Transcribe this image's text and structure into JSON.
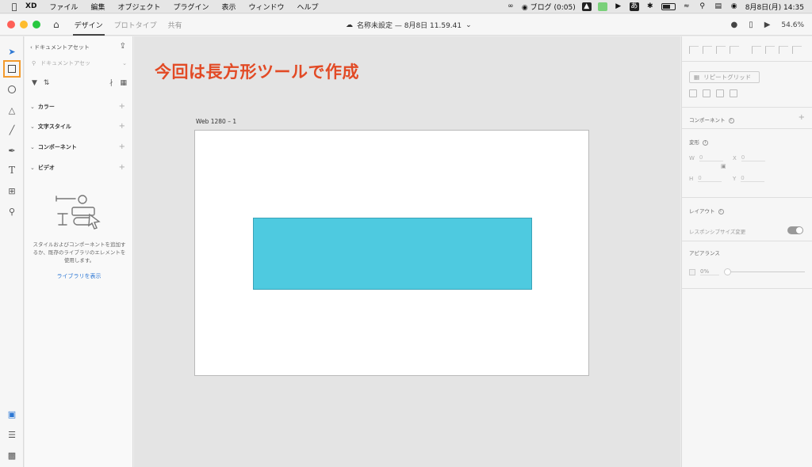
{
  "menubar": {
    "app_name": "XD",
    "items": [
      "ファイル",
      "編集",
      "オブジェクト",
      "プラグイン",
      "表示",
      "ウィンドウ",
      "ヘルプ"
    ],
    "status_blog": "ブログ (0:05)",
    "ime": "あ",
    "clock": "8月8日(月)  14:35"
  },
  "toolbar": {
    "tabs": [
      "デザイン",
      "プロトタイプ",
      "共有"
    ],
    "active_tab": "デザイン",
    "document_title": "名称未設定 — 8月8日 11.59.41",
    "zoom": "54.6%"
  },
  "assets": {
    "title": "ドキュメントアセット",
    "search_placeholder": "ドキュメントアセッ",
    "sections": [
      "カラー",
      "文字スタイル",
      "コンポーネント",
      "ビデオ"
    ],
    "empty_message": "スタイルおよびコンポーネントを追加するか、既存のライブラリのエレメントを使用します。",
    "library_link": "ライブラリを表示"
  },
  "canvas": {
    "annotation": "今回は長方形ツールで作成",
    "artboard_label": "Web 1280 – 1",
    "shape_color": "#4ecae0"
  },
  "inspector": {
    "repeat_grid": "リピートグリッド",
    "component_label": "コンポーネント",
    "transform_label": "変形",
    "w_label": "W",
    "w_value": "0",
    "x_label": "X",
    "x_value": "0",
    "h_label": "H",
    "h_value": "0",
    "y_label": "Y",
    "y_value": "0",
    "layout_label": "レイアウト",
    "responsive_label": "レスポンシブサイズ変更",
    "appearance_label": "アピアランス",
    "opacity_value": "0%"
  },
  "colors": {
    "highlight": "#f39a2c",
    "annotation": "#e24a25",
    "link": "#2e78d4"
  }
}
